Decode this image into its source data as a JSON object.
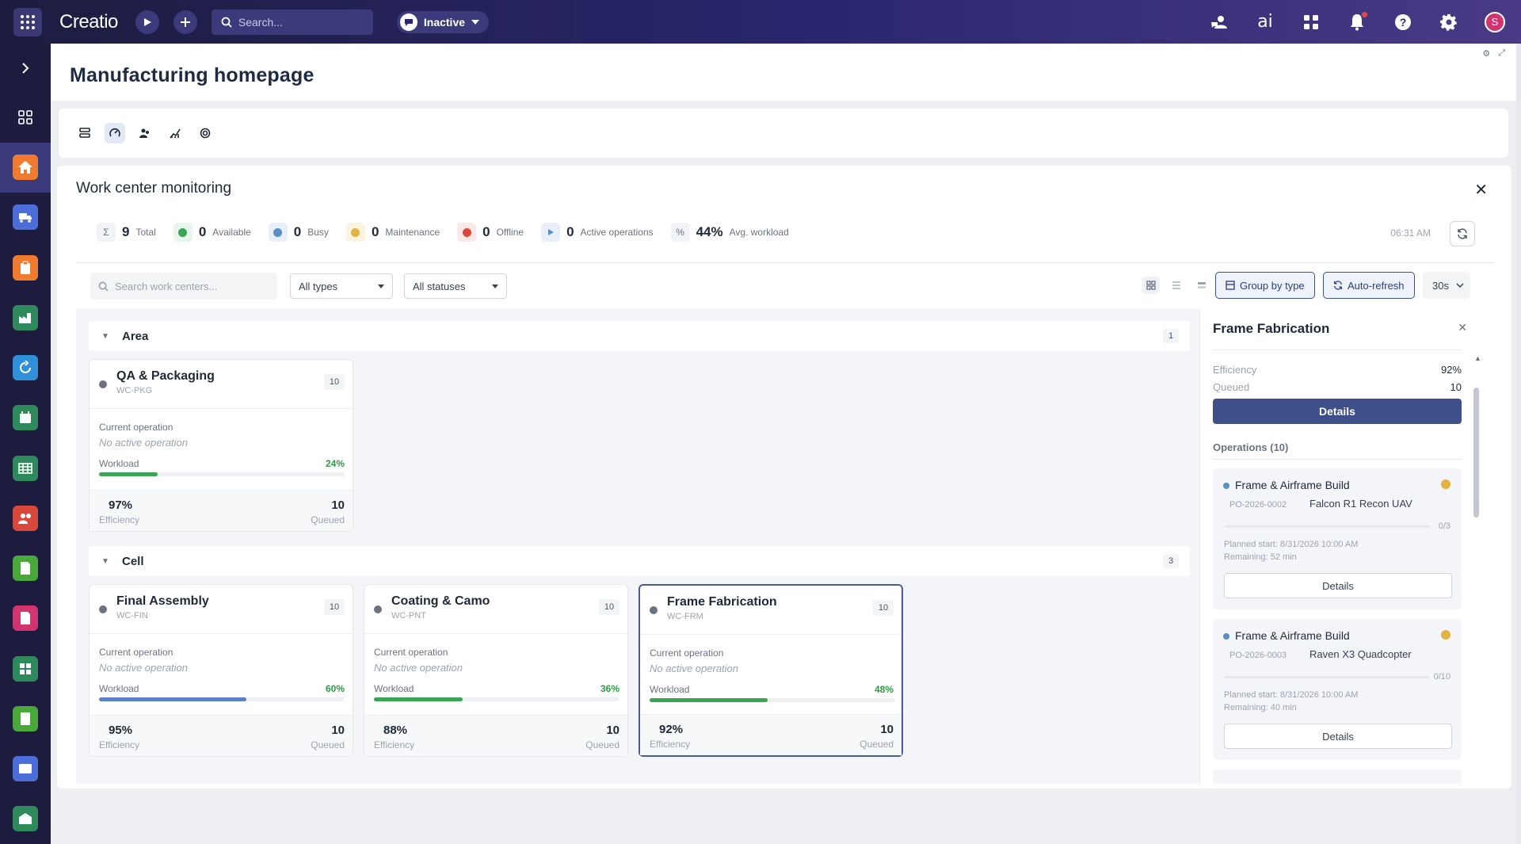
{
  "topbar": {
    "logo": "Creatio",
    "search_placeholder": "Search...",
    "status": "Inactive",
    "avatar_initial": "S"
  },
  "header": {
    "title": "Manufacturing homepage"
  },
  "panel": {
    "title": "Work center monitoring",
    "stats": [
      {
        "value": "9",
        "label": "Total",
        "icon": "sigma-icon"
      },
      {
        "value": "0",
        "label": "Available",
        "color": "#3aa655"
      },
      {
        "value": "0",
        "label": "Busy",
        "color": "#5a8fc6"
      },
      {
        "value": "0",
        "label": "Maintenance",
        "color": "#e3b341"
      },
      {
        "value": "0",
        "label": "Offline",
        "color": "#d9483b"
      },
      {
        "value": "0",
        "label": "Active operations",
        "icon": "play-icon"
      },
      {
        "value": "44%",
        "label": "Avg. workload",
        "icon": "percent-icon"
      }
    ],
    "time": "06:31 AM"
  },
  "filters": {
    "search_placeholder": "Search work centers...",
    "type_select": "All types",
    "status_select": "All statuses",
    "group_btn": "Group by type",
    "auto_refresh_btn": "Auto-refresh",
    "interval": "30s"
  },
  "groups": [
    {
      "name": "Area",
      "count": "1"
    },
    {
      "name": "Cell",
      "count": "3"
    }
  ],
  "cards": [
    {
      "name": "QA & Packaging",
      "code": "WC-PKG",
      "badge": "10",
      "current_label": "Current operation",
      "current_value": "No active operation",
      "workload_label": "Workload",
      "workload": "24%",
      "workload_fraction": 0.24,
      "bar_color": "#3aa655",
      "efficiency": "97%",
      "efficiency_label": "Efficiency",
      "queued": "10",
      "queued_label": "Queued"
    },
    {
      "name": "Final Assembly",
      "code": "WC-FIN",
      "badge": "10",
      "current_label": "Current operation",
      "current_value": "No active operation",
      "workload_label": "Workload",
      "workload": "60%",
      "workload_fraction": 0.6,
      "bar_color": "#5a80c6",
      "efficiency": "95%",
      "efficiency_label": "Efficiency",
      "queued": "10",
      "queued_label": "Queued"
    },
    {
      "name": "Coating & Camo",
      "code": "WC-PNT",
      "badge": "10",
      "current_label": "Current operation",
      "current_value": "No active operation",
      "workload_label": "Workload",
      "workload": "36%",
      "workload_fraction": 0.36,
      "bar_color": "#3aa655",
      "efficiency": "88%",
      "efficiency_label": "Efficiency",
      "queued": "10",
      "queued_label": "Queued"
    },
    {
      "name": "Frame Fabrication",
      "code": "WC-FRM",
      "badge": "10",
      "current_label": "Current operation",
      "current_value": "No active operation",
      "workload_label": "Workload",
      "workload": "48%",
      "workload_fraction": 0.48,
      "bar_color": "#3aa655",
      "efficiency": "92%",
      "efficiency_label": "Efficiency",
      "queued": "10",
      "queued_label": "Queued"
    }
  ],
  "detail": {
    "title": "Frame Fabrication",
    "efficiency_label": "Efficiency",
    "efficiency": "92%",
    "queued_label": "Queued",
    "queued": "10",
    "details_btn": "Details",
    "operations_label": "Operations (10)",
    "operations": [
      {
        "name": "Frame & Airframe Build",
        "code": "PO-2026-0002",
        "product": "Falcon R1 Recon UAV",
        "progress": "0/3",
        "planned": "Planned start: 8/31/2026 10:00 AM",
        "remaining": "Remaining: 52 min",
        "btn": "Details"
      },
      {
        "name": "Frame & Airframe Build",
        "code": "PO-2026-0003",
        "product": "Raven X3 Quadcopter",
        "progress": "0/10",
        "planned": "Planned start: 8/31/2026 10:00 AM",
        "remaining": "Remaining: 40 min",
        "btn": "Details"
      }
    ]
  },
  "colors": {
    "accent": "#3f4f8a",
    "topbar": "#2a2770",
    "sidebar": "#1d1c3f"
  }
}
